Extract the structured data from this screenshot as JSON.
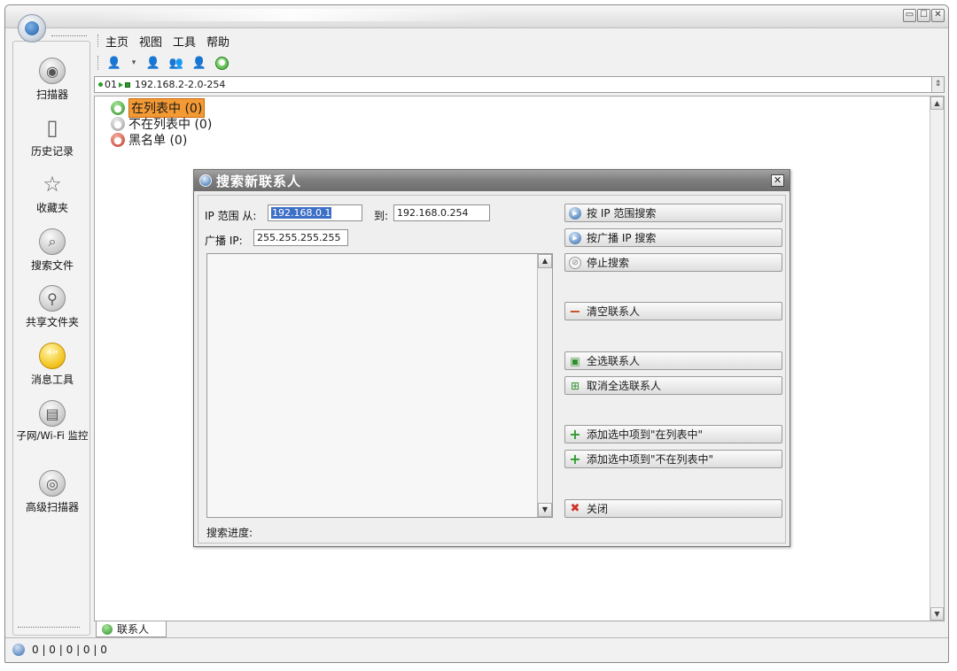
{
  "window": {
    "controls": [
      "▭",
      "☐",
      "✕"
    ]
  },
  "sidebar": {
    "items": [
      {
        "label": "扫描器",
        "icon": "scanner-icon"
      },
      {
        "label": "历史记录",
        "icon": "history-icon"
      },
      {
        "label": "收藏夹",
        "icon": "star-icon"
      },
      {
        "label": "搜索文件",
        "icon": "search-files-icon"
      },
      {
        "label": "共享文件夹",
        "icon": "shared-folder-icon"
      },
      {
        "label": "消息工具",
        "icon": "message-icon"
      },
      {
        "label": "子网/Wi-Fi 监控",
        "icon": "subnet-monitor-icon"
      },
      {
        "label": "高级扫描器",
        "icon": "advanced-scanner-icon"
      }
    ]
  },
  "menu": {
    "items": [
      "主页",
      "视图",
      "工具",
      "帮助"
    ]
  },
  "address": {
    "prefix": "01",
    "value": "192.168.2-2.0-254"
  },
  "tree": {
    "items": [
      {
        "label": "在列表中 (0)",
        "icon": "user-green-icon",
        "selected": true
      },
      {
        "label": "不在列表中 (0)",
        "icon": "user-gray-icon",
        "selected": false
      },
      {
        "label": "黑名单 (0)",
        "icon": "user-red-icon",
        "selected": false
      }
    ]
  },
  "bottom_tab": {
    "label": "联系人"
  },
  "status": {
    "text": "0 | 0 | 0 | 0 | 0"
  },
  "dialog": {
    "title": "搜索新联系人",
    "ip_range_label": "IP 范围 从:",
    "ip_from": "192.168.0.1",
    "to_label": "到:",
    "ip_to": "192.168.0.254",
    "broadcast_label": "广播 IP:",
    "broadcast_ip": "255.255.255.255",
    "progress_label": "搜索进度:",
    "buttons": {
      "search_range": "按 IP 范围搜索",
      "search_broadcast": "按广播 IP 搜索",
      "stop": "停止搜索",
      "clear": "清空联系人",
      "select_all": "全选联系人",
      "deselect_all": "取消全选联系人",
      "add_in_list": "添加选中项到\"在列表中\"",
      "add_not_in_list": "添加选中项到\"不在列表中\"",
      "close": "关闭"
    }
  },
  "colors": {
    "selected_tree_bg": "#f49a33",
    "selection_blue": "#3c6fc6",
    "dialog_title_bg": "#7d7d7d"
  }
}
